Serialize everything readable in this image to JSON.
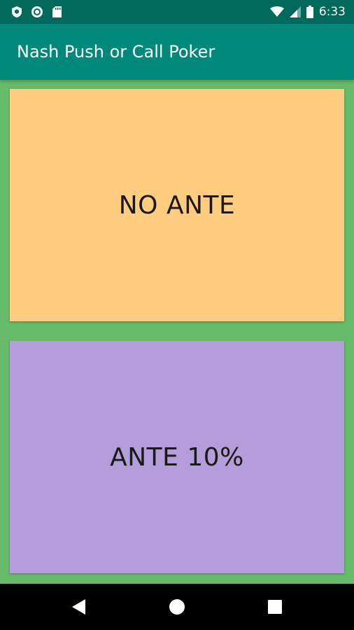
{
  "status_bar": {
    "time": "6:33",
    "left_icons": [
      "shield-icon",
      "circle-record-icon",
      "sd-card-icon"
    ],
    "right_icons": [
      "wifi-icon",
      "cell-signal-icon",
      "battery-icon"
    ]
  },
  "app_bar": {
    "title": "Nash Push or Call Poker"
  },
  "cards": [
    {
      "label": "NO ANTE",
      "color": "#ffcc80"
    },
    {
      "label": "ANTE 10%",
      "color": "#b39ddb"
    }
  ],
  "nav_bar": {
    "buttons": [
      "back-icon",
      "home-icon",
      "recents-icon"
    ]
  },
  "colors": {
    "status_bar": "#00695c",
    "app_bar": "#00897b",
    "background": "#66bb6a"
  }
}
